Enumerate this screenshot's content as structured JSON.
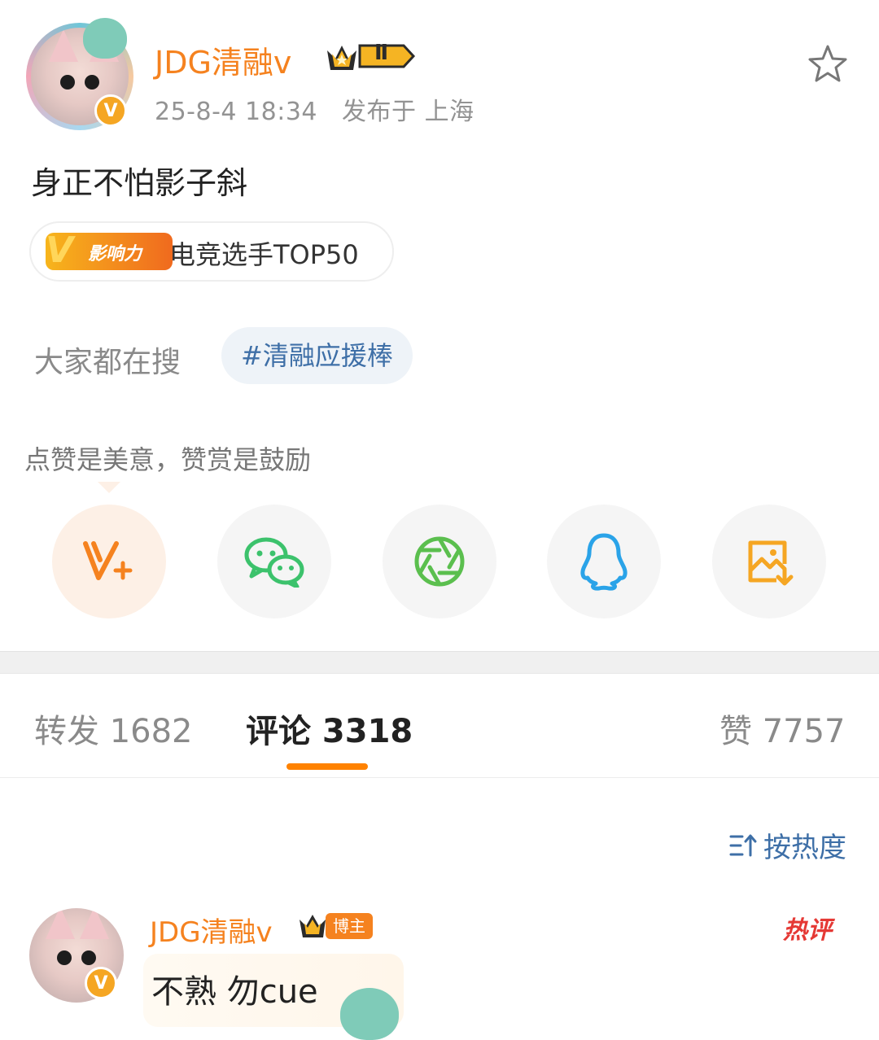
{
  "post": {
    "username": "JDG清融v",
    "level_badge": "Ⅱ",
    "timestamp": "25-8-4 18:34",
    "location_text": "发布于 上海",
    "text": "身正不怕影子斜",
    "influence": {
      "logo_text": "影响力",
      "label": "电竞选手TOP50"
    },
    "search": {
      "label": "大家都在搜",
      "tag": "#清融应援棒"
    }
  },
  "appreciation": {
    "prompt": "点赞是美意，赞赏是鼓励"
  },
  "share_actions": [
    {
      "name": "reward",
      "icon": "v-plus-icon",
      "color": "#f5821f"
    },
    {
      "name": "wechat",
      "icon": "wechat-icon",
      "color": "#3cc26c"
    },
    {
      "name": "moments",
      "icon": "moments-aperture-icon",
      "color": "#5bbf4e"
    },
    {
      "name": "qq",
      "icon": "qq-penguin-icon",
      "color": "#2aa3e8"
    },
    {
      "name": "save-image",
      "icon": "save-image-icon",
      "color": "#f5a623"
    }
  ],
  "tabs": {
    "repost": "转发 1682",
    "comments": "评论 3318",
    "likes": "赞 7757",
    "active": "comments"
  },
  "sort": {
    "label": "按热度"
  },
  "comment": {
    "username": "JDG清融v",
    "badge": "博主",
    "text": "不熟 勿cue",
    "hot_label": "热评"
  },
  "colors": {
    "accent": "#f5821f",
    "link": "#3e6fa7",
    "tab_indicator": "#ff8200"
  }
}
